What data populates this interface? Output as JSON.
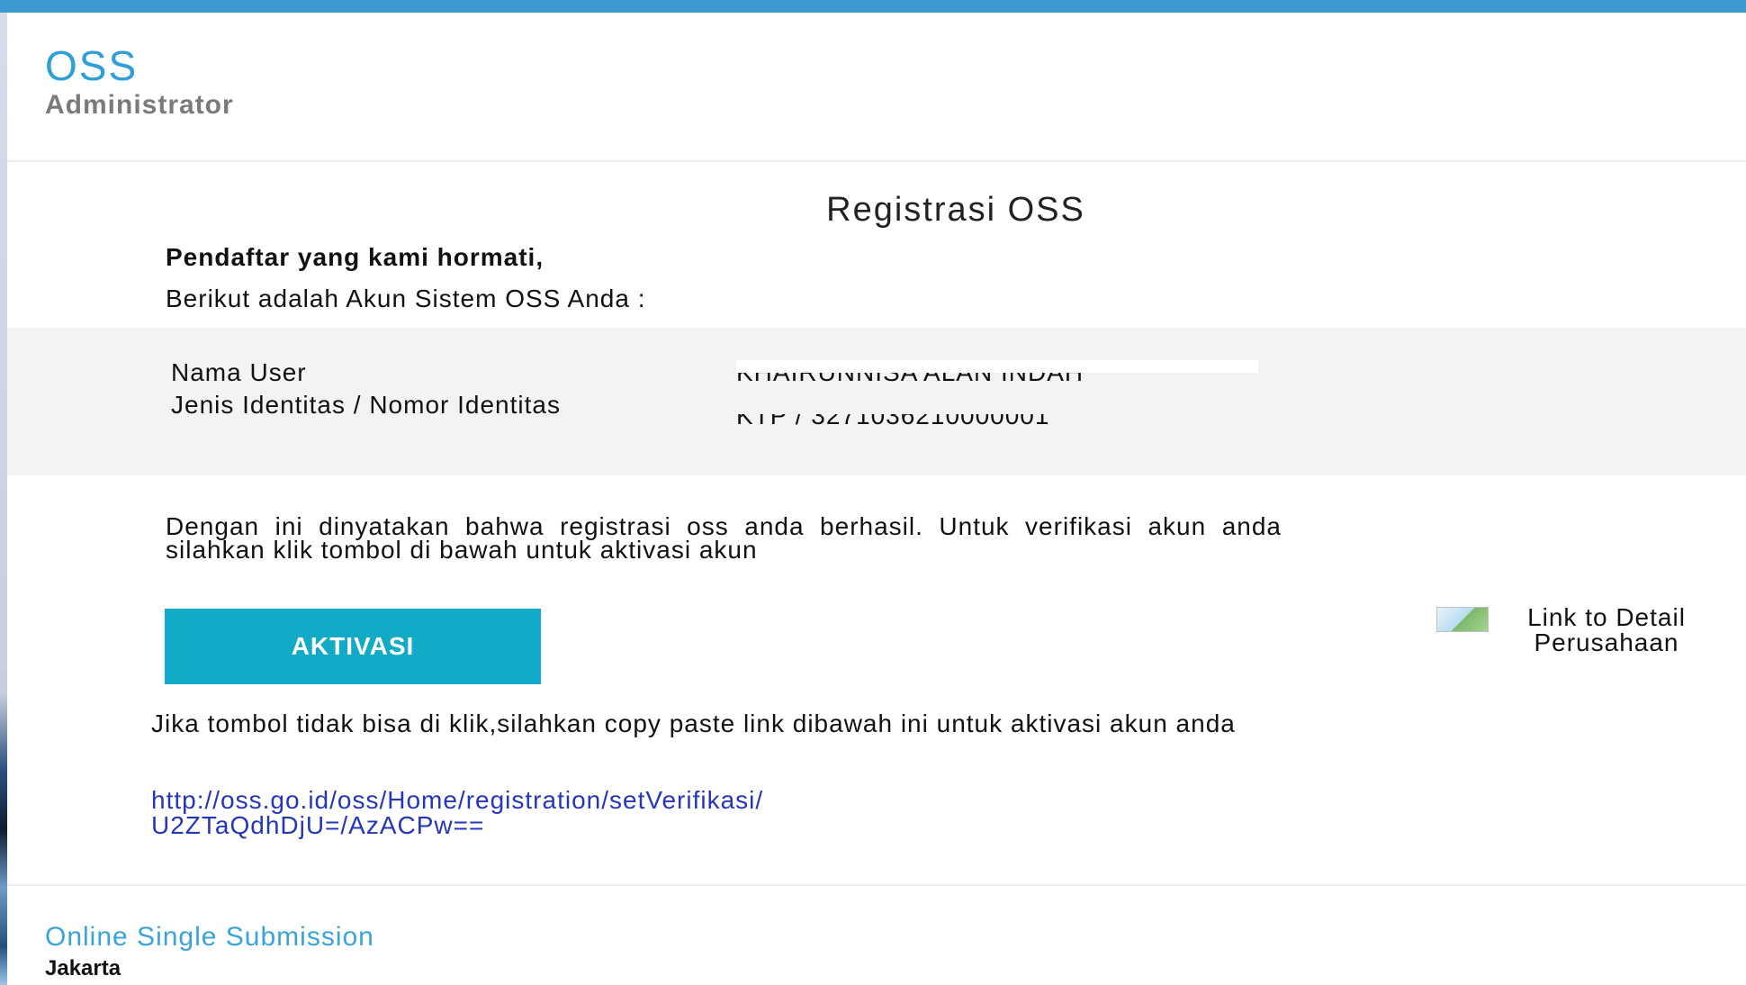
{
  "header": {
    "brand": "OSS",
    "subtitle": "Administrator"
  },
  "email": {
    "title": "Registrasi OSS",
    "greeting": "Pendaftar yang kami hormati,",
    "intro": "Berikut adalah Akun Sistem OSS Anda :",
    "account": {
      "username_label": "Nama User",
      "username_value": "KHAIRUNNISA ALAN INDAH",
      "identity_label": "Jenis Identitas / Nomor Identitas",
      "identity_value": "KTP / 3271036210000001"
    },
    "message": "Dengan ini dinyatakan bahwa registrasi oss anda berhasil. Untuk verifikasi akun anda silahkan klik tombol di bawah untuk aktivasi akun",
    "activate_button": "AKTIVASI",
    "side_image_alt": "Link to Detail Perusahaan",
    "fallback_text": "Jika tombol tidak bisa di klik,silahkan copy paste link dibawah ini untuk aktivasi akun anda",
    "activation_link_line1": "http://oss.go.id/oss/Home/registration/setVerifikasi/",
    "activation_link_line2": "U2ZTaQdhDjU=/AzACPw=="
  },
  "footer": {
    "org": "Online Single Submission",
    "city": "Jakarta"
  },
  "colors": {
    "top_bar": "#3d9ad1",
    "brand": "#2f9fd6",
    "button": "#12aac7",
    "link": "#2537b8"
  }
}
